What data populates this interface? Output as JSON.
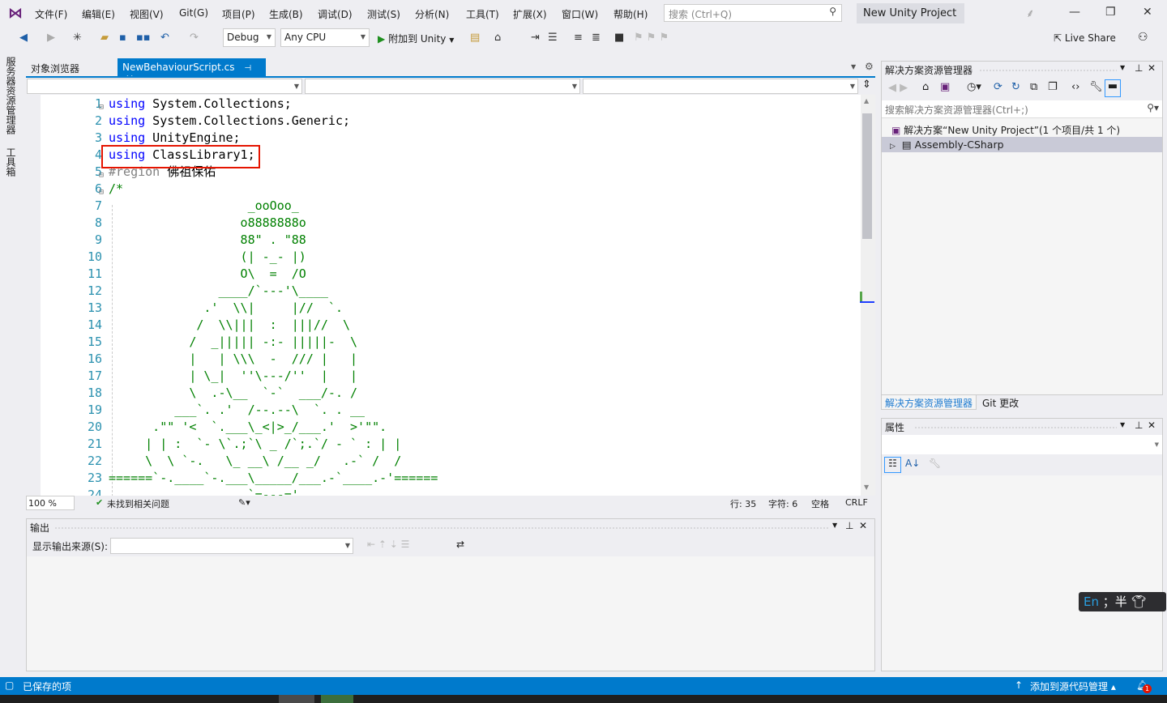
{
  "menu": {
    "items": [
      "文件(F)",
      "编辑(E)",
      "视图(V)",
      "Git(G)",
      "项目(P)",
      "生成(B)",
      "调试(D)",
      "测试(S)",
      "分析(N)",
      "工具(T)",
      "扩展(X)",
      "窗口(W)",
      "帮助(H)"
    ],
    "search_placeholder": "搜索 (Ctrl+Q)",
    "project_title": "New Unity Project"
  },
  "toolbar": {
    "config": "Debug",
    "platform": "Any CPU",
    "attach_label": "附加到 Unity",
    "live_share": "Live Share"
  },
  "left_strip": {
    "server_explorer": "服务器资源管理器",
    "toolbox": "工具箱"
  },
  "tabs": [
    {
      "label": "对象浏览器",
      "active": false
    },
    {
      "label": "NewBehaviourScript.cs",
      "active": true
    }
  ],
  "editor": {
    "lines": [
      [
        {
          "t": "using",
          "k": "kw"
        },
        {
          "t": " System.Collections;",
          "k": "pl"
        }
      ],
      [
        {
          "t": "using",
          "k": "kw"
        },
        {
          "t": " System.Collections.Generic;",
          "k": "pl"
        }
      ],
      [
        {
          "t": "using",
          "k": "kw"
        },
        {
          "t": " UnityEngine;",
          "k": "pl"
        }
      ],
      [
        {
          "t": "using",
          "k": "kw"
        },
        {
          "t": " ClassLibrary1;",
          "k": "pl"
        }
      ],
      [
        {
          "t": "#region ",
          "k": "rg"
        },
        {
          "t": "佛祖保佑",
          "k": "pl"
        }
      ],
      [
        {
          "t": "/*",
          "k": "cm"
        }
      ],
      [
        {
          "t": "                   _ooOoo_",
          "k": "cm"
        }
      ],
      [
        {
          "t": "                  o8888888o",
          "k": "cm"
        }
      ],
      [
        {
          "t": "                  88\" . \"88",
          "k": "cm"
        }
      ],
      [
        {
          "t": "                  (| -_- |)",
          "k": "cm"
        }
      ],
      [
        {
          "t": "                  O\\  =  /O",
          "k": "cm"
        }
      ],
      [
        {
          "t": "               ____/`---'\\____",
          "k": "cm"
        }
      ],
      [
        {
          "t": "             .'  \\\\|     |//  `.",
          "k": "cm"
        }
      ],
      [
        {
          "t": "            /  \\\\|||  :  |||//  \\",
          "k": "cm"
        }
      ],
      [
        {
          "t": "           /  _||||| -:- |||||-  \\",
          "k": "cm"
        }
      ],
      [
        {
          "t": "           |   | \\\\\\  -  /// |   |",
          "k": "cm"
        }
      ],
      [
        {
          "t": "           | \\_|  ''\\---/''  |   |",
          "k": "cm"
        }
      ],
      [
        {
          "t": "           \\  .-\\__  `-`  ___/-. /",
          "k": "cm"
        }
      ],
      [
        {
          "t": "         ___`. .'  /--.--\\  `. . __",
          "k": "cm"
        }
      ],
      [
        {
          "t": "      .\"\" '<  `.___\\_<|>_/___.'  >'\"\".",
          "k": "cm"
        }
      ],
      [
        {
          "t": "     | | :  `- \\`.;`\\ _ /`;.`/ - ` : | |",
          "k": "cm"
        }
      ],
      [
        {
          "t": "     \\  \\ `-.   \\_ __\\ /__ _/   .-` /  /",
          "k": "cm"
        }
      ],
      [
        {
          "t": "======`-.____`-.___\\_____/___.-`____.-'======",
          "k": "cm"
        }
      ],
      [
        {
          "t": "                   `=---='",
          "k": "cm"
        }
      ]
    ],
    "zoom": "100 %",
    "issues": "未找到相关问题",
    "line": "行: 35",
    "char": "字符: 6",
    "spaces": "空格",
    "eol": "CRLF"
  },
  "output": {
    "title": "输出",
    "source_label": "显示输出来源(S):"
  },
  "solution_explorer": {
    "title": "解决方案资源管理器",
    "search_placeholder": "搜索解决方案资源管理器(Ctrl+;)",
    "solution": "解决方案“New Unity Project”(1 个项目/共 1 个)",
    "project": "Assembly-CSharp",
    "bottom_tabs": [
      "解决方案资源管理器",
      "Git 更改"
    ]
  },
  "properties": {
    "title": "属性"
  },
  "status": {
    "saved": "已保存的项",
    "source_control": "添加到源代码管理",
    "notifications": "1"
  },
  "ime": {
    "lang": "En",
    "punct": "；",
    "width": "半"
  },
  "colors": {
    "accent": "#007acc",
    "keyword": "#0000ff",
    "comment": "#008000",
    "line_number": "#2b91af",
    "highlight_box": "#e51400"
  }
}
